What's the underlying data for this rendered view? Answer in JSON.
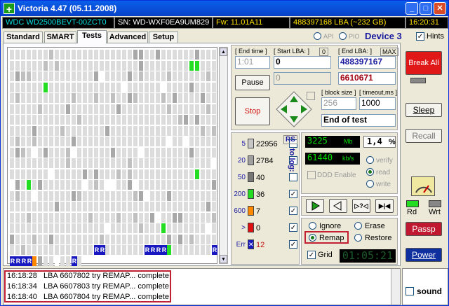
{
  "window": {
    "title": "Victoria 4.47 (05.11.2008)",
    "icon": "plus-icon"
  },
  "infobar": {
    "model": "WDC WD2500BEVT-00ZCT0",
    "serial": "SN: WD-WXF0EA9UM829",
    "firmware": "Fw: 11.01A11",
    "lba": "488397168 LBA (~232 GB)",
    "clock": "16:20:31"
  },
  "tabs": [
    "Standard",
    "SMART",
    "Tests",
    "Advanced",
    "Setup"
  ],
  "active_tab": "Tests",
  "port": {
    "api": "API",
    "pio": "PIO",
    "device": "Device 3",
    "hints": "Hints"
  },
  "controls": {
    "end_time_label": "[ End time ]",
    "end_time_value": "1:01",
    "start_lba_label": "[ Start LBA: ]",
    "start_lba_zero": "0",
    "start_lba_value": "0",
    "start_lba_current": "0",
    "end_lba_label": "[ End LBA: ]",
    "end_lba_max": "MAX",
    "end_lba_value": "488397167",
    "current_lba": "6610671",
    "pause": "Pause",
    "stop": "Stop",
    "block_size_label": "[ block size ]",
    "block_size_value": "256",
    "timeout_label": "[ timeout,ms ]",
    "timeout_value": "1000",
    "end_mode": "End of test"
  },
  "blocks": [
    {
      "label": "5",
      "count": "22956",
      "color": "#c8c8c8"
    },
    {
      "label": "20",
      "count": "2784",
      "color": "#a0a0a0"
    },
    {
      "label": "50",
      "count": "40",
      "color": "#787878"
    },
    {
      "label": "200",
      "count": "36",
      "color": "#22dd22"
    },
    {
      "label": "600",
      "count": "7",
      "color": "#ff8800"
    },
    {
      "label": ">",
      "count": "0",
      "color": "#dd1111"
    },
    {
      "label": "Err",
      "count": "12",
      "color": "#1818c0"
    }
  ],
  "rs_label": "RS",
  "to_log_label": "to log:",
  "rates": {
    "mb": "3225",
    "mb_unit": "Mb",
    "percent": "1,4",
    "percent_unit": "%",
    "speed": "61440",
    "speed_unit": "kb/s",
    "ddd": "DDD Enable",
    "verify": "verify",
    "read": "read",
    "write": "write"
  },
  "actions": {
    "ignore": "Ignore",
    "erase": "Erase",
    "remap": "Remap",
    "restore": "Restore",
    "grid": "Grid",
    "timer": "01:05:21"
  },
  "right": {
    "break_all": "Break All",
    "sleep": "Sleep",
    "recall": "Recall",
    "rd": "Rd",
    "wrt": "Wrt",
    "passp": "Passp",
    "power": "Power",
    "sound": "sound"
  },
  "log": [
    {
      "time": "16:18:28",
      "text": "LBA 6607802 try REMAP... complete"
    },
    {
      "time": "16:18:34",
      "text": "LBA 6607803 try REMAP... complete"
    },
    {
      "time": "16:18:40",
      "text": "LBA 6607804 try REMAP... complete"
    }
  ]
}
